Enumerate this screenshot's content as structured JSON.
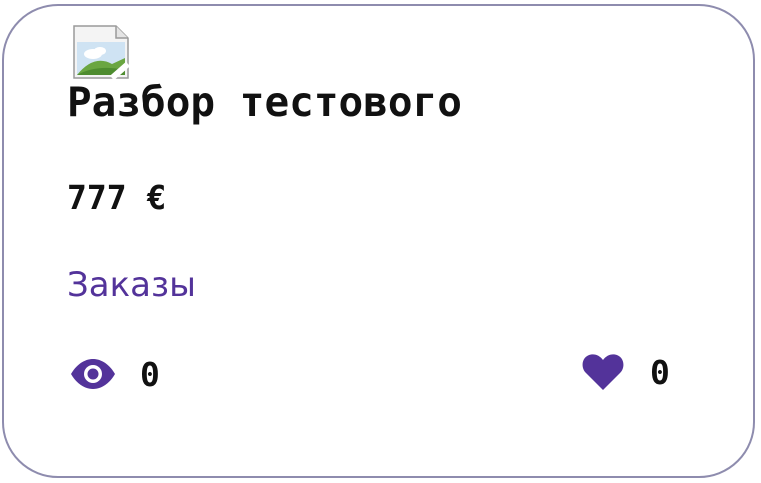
{
  "card": {
    "image_icon": "broken-image-icon",
    "title": "Разбор тестового",
    "price": "777 €",
    "category": "Заказы",
    "views": {
      "icon": "eye-icon",
      "count": "0"
    },
    "likes": {
      "icon": "heart-icon",
      "count": "0"
    }
  },
  "colors": {
    "accent": "#53339a",
    "border": "#8e8cae",
    "text": "#111111"
  }
}
